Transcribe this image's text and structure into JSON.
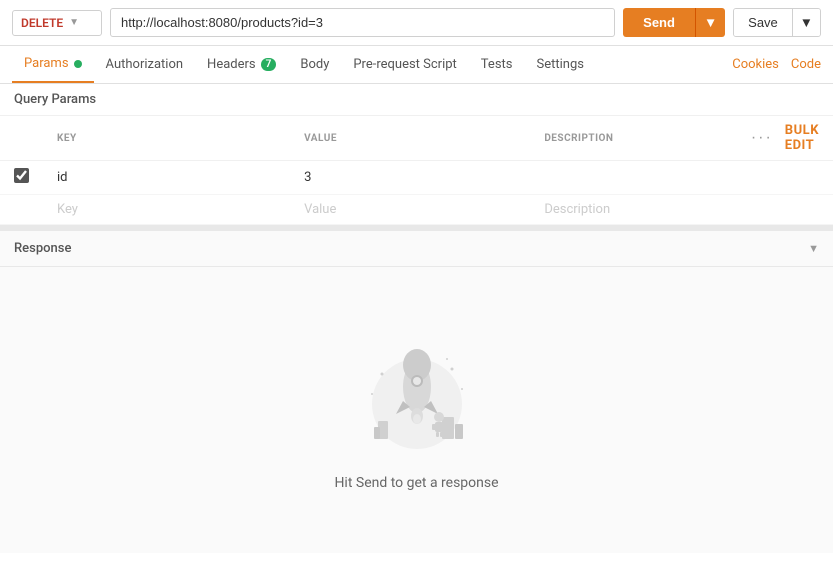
{
  "topbar": {
    "method": "DELETE",
    "method_chevron": "▼",
    "url": "http://localhost:8080/products?id=3",
    "send_label": "Send",
    "send_chevron": "▼",
    "save_label": "Save",
    "save_chevron": "▼"
  },
  "tabs": {
    "items": [
      {
        "id": "params",
        "label": "Params",
        "active": true,
        "dot": true,
        "badge": null
      },
      {
        "id": "authorization",
        "label": "Authorization",
        "active": false,
        "dot": false,
        "badge": null
      },
      {
        "id": "headers",
        "label": "Headers",
        "active": false,
        "dot": false,
        "badge": "7"
      },
      {
        "id": "body",
        "label": "Body",
        "active": false,
        "dot": false,
        "badge": null
      },
      {
        "id": "prerequest",
        "label": "Pre-request Script",
        "active": false,
        "dot": false,
        "badge": null
      },
      {
        "id": "tests",
        "label": "Tests",
        "active": false,
        "dot": false,
        "badge": null
      },
      {
        "id": "settings",
        "label": "Settings",
        "active": false,
        "dot": false,
        "badge": null
      }
    ],
    "right_links": [
      {
        "id": "cookies",
        "label": "Cookies"
      },
      {
        "id": "code",
        "label": "Code"
      }
    ]
  },
  "query_params": {
    "section_label": "Query Params",
    "columns": {
      "key": "KEY",
      "value": "VALUE",
      "description": "DESCRIPTION"
    },
    "bulk_edit_label": "Bulk Edit",
    "rows": [
      {
        "checked": true,
        "key": "id",
        "value": "3",
        "description": ""
      }
    ],
    "empty_row": {
      "key_placeholder": "Key",
      "value_placeholder": "Value",
      "description_placeholder": "Description"
    }
  },
  "response": {
    "title": "Response",
    "chevron": "▼",
    "empty_text": "Hit Send to get a response"
  },
  "icons": {
    "dots": "···",
    "chevron_down": "▼"
  }
}
